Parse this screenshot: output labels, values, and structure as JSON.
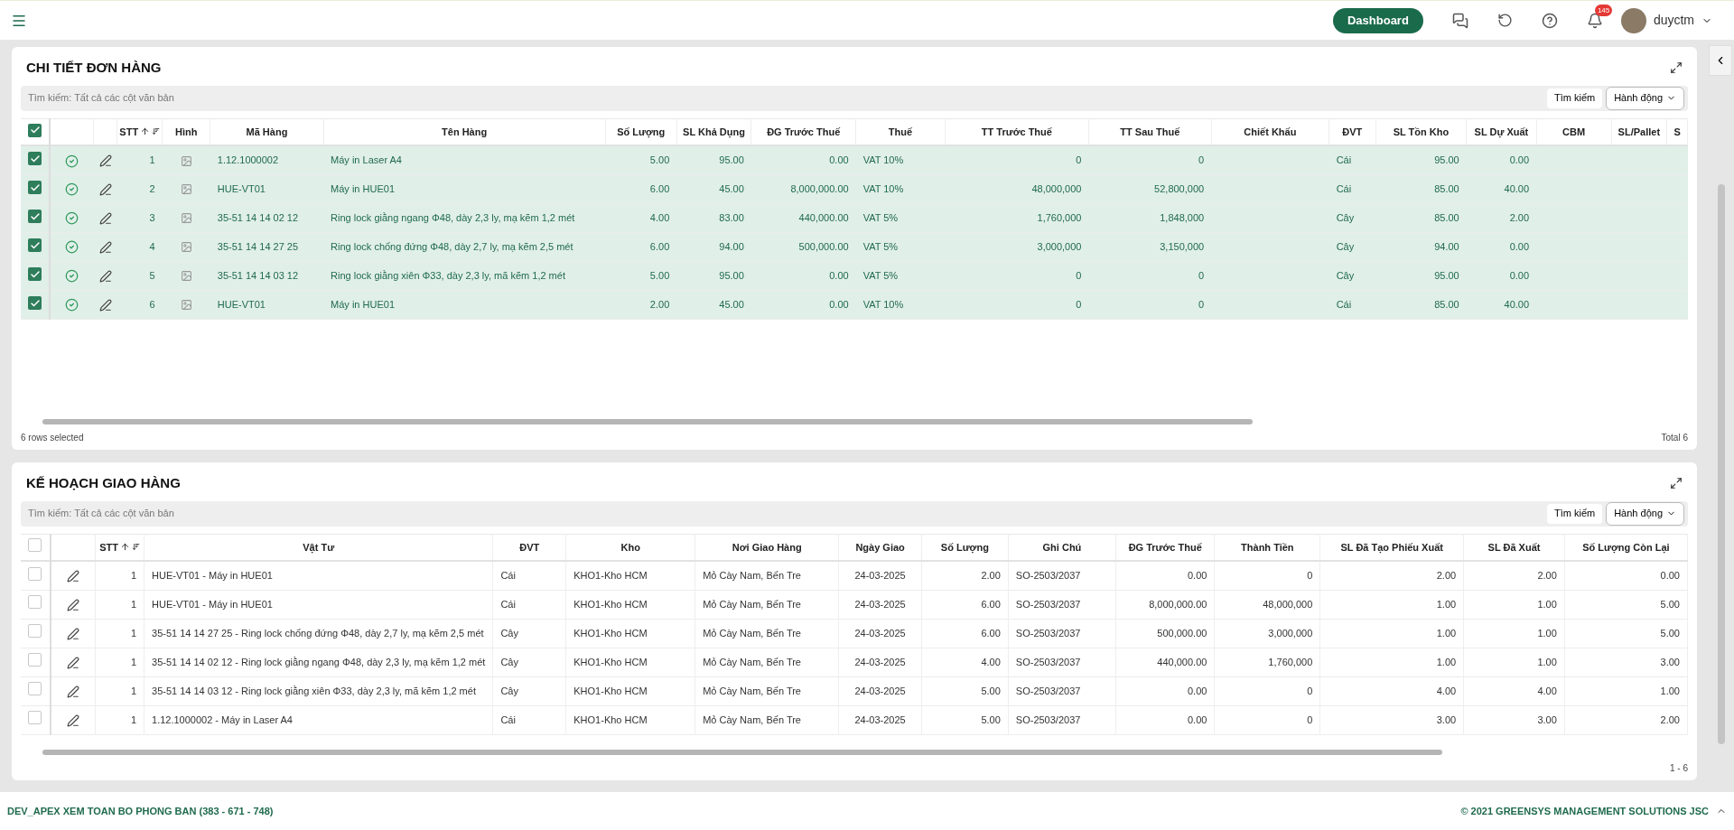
{
  "topbar": {
    "dashboard_button": "Dashboard",
    "notification_count": "145",
    "username": "duyctm"
  },
  "order_details": {
    "title": "CHI TIẾT ĐƠN HÀNG",
    "search": {
      "placeholder": "Tìm kiếm: Tất cả các cột văn bản"
    },
    "search_button": "Tìm kiếm",
    "actions_button": "Hành động",
    "all_checked": true,
    "columns": [
      "STT",
      "Hình",
      "Mã Hàng",
      "Tên Hàng",
      "Số Lượng",
      "SL Khả Dụng",
      "ĐG Trước Thuế",
      "Thuế",
      "TT Trước Thuế",
      "TT Sau Thuế",
      "Chiết Khấu",
      "ĐVT",
      "SL Tồn Kho",
      "SL Dự Xuất",
      "CBM",
      "SL/Pallet",
      "S"
    ],
    "rows": [
      {
        "checked": true,
        "cells": [
          "1",
          "",
          "1.12.1000002",
          "Máy in Laser A4",
          "5.00",
          "95.00",
          "0.00",
          "VAT 10%",
          "0",
          "0",
          "",
          "Cái",
          "95.00",
          "0.00",
          "",
          "",
          ""
        ]
      },
      {
        "checked": true,
        "cells": [
          "2",
          "",
          "HUE-VT01",
          "Máy in HUE01",
          "6.00",
          "45.00",
          "8,000,000.00",
          "VAT 10%",
          "48,000,000",
          "52,800,000",
          "",
          "Cái",
          "85.00",
          "40.00",
          "",
          "",
          ""
        ]
      },
      {
        "checked": true,
        "cells": [
          "3",
          "",
          "35-51 14 14 02 12",
          "Ring lock giằng ngang Φ48, dày 2,3 ly, mạ kẽm 1,2 mét",
          "4.00",
          "83.00",
          "440,000.00",
          "VAT 5%",
          "1,760,000",
          "1,848,000",
          "",
          "Cây",
          "85.00",
          "2.00",
          "",
          "",
          ""
        ]
      },
      {
        "checked": true,
        "cells": [
          "4",
          "",
          "35-51 14 14 27 25",
          "Ring lock chống đứng Φ48, dày 2,7 ly, mạ kẽm 2,5 mét",
          "6.00",
          "94.00",
          "500,000.00",
          "VAT 5%",
          "3,000,000",
          "3,150,000",
          "",
          "Cây",
          "94.00",
          "0.00",
          "",
          "",
          ""
        ]
      },
      {
        "checked": true,
        "cells": [
          "5",
          "",
          "35-51 14 14 03 12",
          "Ring lock giằng xiên Φ33, dày 2,3 ly, mã kẽm 1,2 mét",
          "5.00",
          "95.00",
          "0.00",
          "VAT 5%",
          "0",
          "0",
          "",
          "Cây",
          "95.00",
          "0.00",
          "",
          "",
          ""
        ]
      },
      {
        "checked": true,
        "cells": [
          "6",
          "",
          "HUE-VT01",
          "Máy in HUE01",
          "2.00",
          "45.00",
          "0.00",
          "VAT 10%",
          "0",
          "0",
          "",
          "Cái",
          "85.00",
          "40.00",
          "",
          "",
          ""
        ]
      }
    ],
    "footer_left": "6 rows selected",
    "footer_right": "Total 6"
  },
  "delivery_plan": {
    "title": "KẾ HOẠCH GIAO HÀNG",
    "search": {
      "placeholder": "Tìm kiếm: Tất cả các cột văn bản"
    },
    "search_button": "Tìm kiếm",
    "actions_button": "Hành động",
    "all_checked": false,
    "columns": [
      "STT",
      "Vật Tư",
      "ĐVT",
      "Kho",
      "Nơi Giao Hàng",
      "Ngày Giao",
      "Số Lượng",
      "Ghi Chú",
      "ĐG Trước Thuế",
      "Thành Tiền",
      "SL Đã Tạo Phiếu Xuất",
      "SL Đã Xuất",
      "Số Lượng Còn Lại"
    ],
    "rows": [
      {
        "checked": false,
        "cells": [
          "1",
          "HUE-VT01 - Máy in HUE01",
          "Cái",
          "KHO1-Kho HCM",
          "Mỏ Cày Nam, Bến Tre",
          "24-03-2025",
          "2.00",
          "SO-2503/2037",
          "0.00",
          "0",
          "2.00",
          "2.00",
          "0.00"
        ]
      },
      {
        "checked": false,
        "cells": [
          "1",
          "HUE-VT01 - Máy in HUE01",
          "Cái",
          "KHO1-Kho HCM",
          "Mỏ Cày Nam, Bến Tre",
          "24-03-2025",
          "6.00",
          "SO-2503/2037",
          "8,000,000.00",
          "48,000,000",
          "1.00",
          "1.00",
          "5.00"
        ]
      },
      {
        "checked": false,
        "cells": [
          "1",
          "35-51 14 14 27 25 - Ring lock chống đứng Φ48, dày 2,7 ly, mạ kẽm 2,5 mét",
          "Cây",
          "KHO1-Kho HCM",
          "Mỏ Cày Nam, Bến Tre",
          "24-03-2025",
          "6.00",
          "SO-2503/2037",
          "500,000.00",
          "3,000,000",
          "1.00",
          "1.00",
          "5.00"
        ]
      },
      {
        "checked": false,
        "cells": [
          "1",
          "35-51 14 14 02 12 - Ring lock giằng ngang Φ48, dày 2,3 ly, mạ kẽm 1,2 mét",
          "Cây",
          "KHO1-Kho HCM",
          "Mỏ Cày Nam, Bến Tre",
          "24-03-2025",
          "4.00",
          "SO-2503/2037",
          "440,000.00",
          "1,760,000",
          "1.00",
          "1.00",
          "3.00"
        ]
      },
      {
        "checked": false,
        "cells": [
          "1",
          "35-51 14 14 03 12 - Ring lock giằng xiên Φ33, dày 2,3 ly, mã kẽm 1,2 mét",
          "Cây",
          "KHO1-Kho HCM",
          "Mỏ Cày Nam, Bến Tre",
          "24-03-2025",
          "5.00",
          "SO-2503/2037",
          "0.00",
          "0",
          "4.00",
          "4.00",
          "1.00"
        ]
      },
      {
        "checked": false,
        "cells": [
          "1",
          "1.12.1000002 - Máy in Laser A4",
          "Cái",
          "KHO1-Kho HCM",
          "Mỏ Cày Nam, Bến Tre",
          "24-03-2025",
          "5.00",
          "SO-2503/2037",
          "0.00",
          "0",
          "3.00",
          "3.00",
          "2.00"
        ]
      }
    ],
    "footer_right": "1 - 6"
  },
  "status_bar": {
    "left": "DEV_APEX XEM TOAN BO PHONG BAN (383 - 671 - 748)",
    "right": "© 2021 GREENSYS MANAGEMENT SOLUTIONS JSC"
  }
}
